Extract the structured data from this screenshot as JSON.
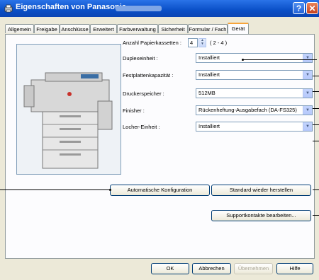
{
  "window": {
    "title": "Eigenschaften von Panasonic",
    "help_label": "?",
    "close_label": "✕",
    "icon": "printer-icon"
  },
  "tabs": [
    {
      "label": "Allgemein"
    },
    {
      "label": "Freigabe"
    },
    {
      "label": "Anschlüsse"
    },
    {
      "label": "Erweitert"
    },
    {
      "label": "Farbverwaltung"
    },
    {
      "label": "Sicherheit"
    },
    {
      "label": "Formular / Fach"
    },
    {
      "label": "Gerät",
      "active": true
    }
  ],
  "device": {
    "paper_trays_label": "Anzahl Papierkassetten :",
    "paper_trays_value": "4",
    "paper_trays_range": "( 2 - 4 )",
    "duplex_label": "Duplexeinheit :",
    "duplex_value": "Installiert",
    "hdd_label": "Festplattenkapazität :",
    "hdd_value": "Installiert",
    "memory_label": "Druckerspeicher :",
    "memory_value": "512MB",
    "finisher_label": "Finisher :",
    "finisher_value": "Rückenheftung-Ausgabefach (DA-FS325)",
    "punch_label": "Locher-Einheit :",
    "punch_value": "Installiert"
  },
  "actions": {
    "auto_config": "Automatische Konfiguration",
    "restore_default": "Standard wieder herstellen",
    "support_contacts": "Supportkontakte bearbeiten..."
  },
  "footer": {
    "ok": "OK",
    "cancel": "Abbrechen",
    "apply": "Übernehmen",
    "help": "Hilfe"
  }
}
